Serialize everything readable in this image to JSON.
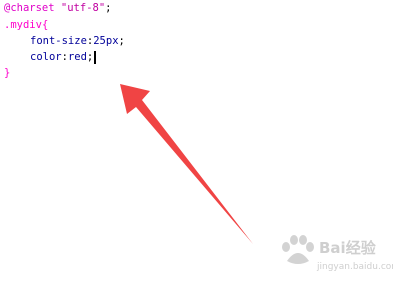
{
  "editor": {
    "lines": {
      "line1": {
        "at_rule": "@charset",
        "space": " ",
        "string": "\"utf-8\"",
        "semicolon": ";"
      },
      "line2": {
        "selector": ".mydiv",
        "open_brace": "{"
      },
      "line3": {
        "property": "font-size",
        "colon": ":",
        "value": "25px",
        "semicolon": ";"
      },
      "line4": {
        "property": "color",
        "colon": ":",
        "value": "red",
        "semicolon": ";"
      },
      "line5": {
        "close_brace": "}"
      }
    }
  },
  "colors": {
    "arrow": "#f04444",
    "at_rule": "#e000c8",
    "selector": "#ff00cc",
    "property": "#000099"
  },
  "watermark": {
    "icon": "paw-icon",
    "brand": "Bai经验",
    "sub": "jingyan.baidu.com"
  }
}
